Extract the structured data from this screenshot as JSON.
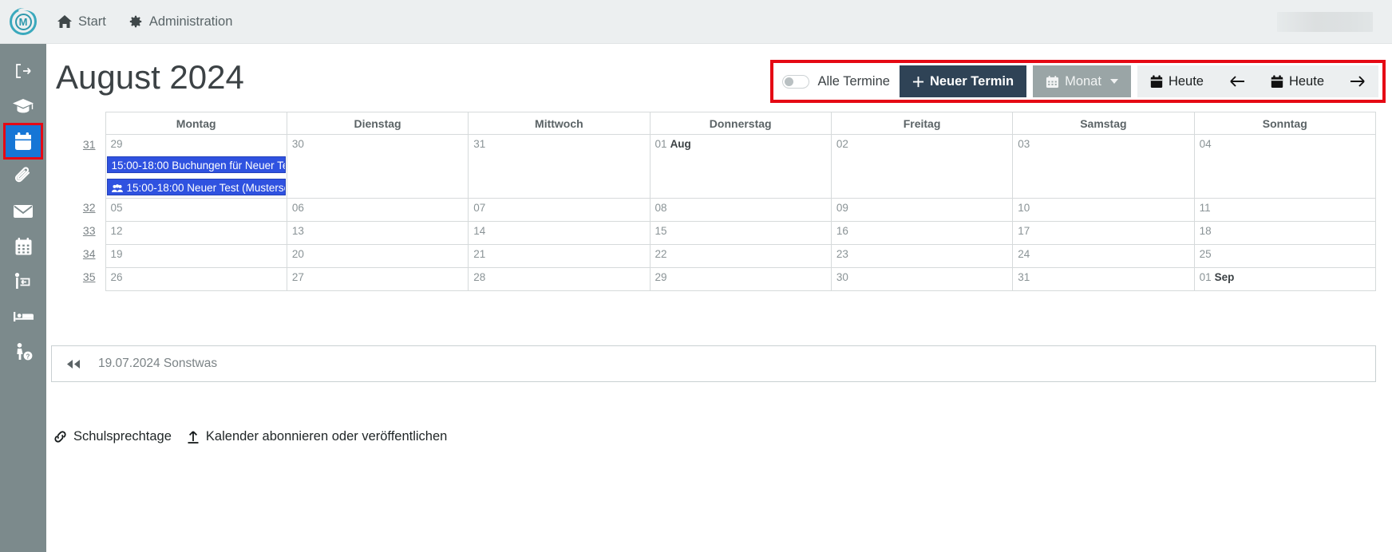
{
  "topbar": {
    "logo_letter": "M",
    "items": [
      {
        "label": "Start",
        "icon": "home-icon"
      },
      {
        "label": "Administration",
        "icon": "gear-icon"
      }
    ]
  },
  "sidebar": {
    "items": [
      {
        "icon": "logout-icon",
        "name": "sidebar-item-logout",
        "active": false
      },
      {
        "icon": "graduation-cap-icon",
        "name": "sidebar-item-school",
        "active": false
      },
      {
        "icon": "calendar-day-icon",
        "name": "sidebar-item-calendar",
        "active": true
      },
      {
        "icon": "paperclip-icon",
        "name": "sidebar-item-files",
        "active": false
      },
      {
        "icon": "envelope-icon",
        "name": "sidebar-item-messages",
        "active": false
      },
      {
        "icon": "calendar-grid-icon",
        "name": "sidebar-item-timetable",
        "active": false
      },
      {
        "icon": "person-exit-icon",
        "name": "sidebar-item-absence",
        "active": false
      },
      {
        "icon": "bed-icon",
        "name": "sidebar-item-boarding",
        "active": false
      },
      {
        "icon": "person-question-icon",
        "name": "sidebar-item-help",
        "active": false
      }
    ]
  },
  "page": {
    "title": "August 2024"
  },
  "toolbar": {
    "toggle_label": "Alle Termine",
    "toggle_on": false,
    "new_appointment": "Neuer Termin",
    "view_label": "Monat",
    "today_label": "Heute",
    "today_label_2": "Heute",
    "prev_icon": "arrow-left-icon",
    "next_icon": "arrow-right-icon",
    "highlight_color": "#e50914",
    "primary_color": "#2f4356"
  },
  "calendar": {
    "weekday_headers": [
      "Montag",
      "Dienstag",
      "Mittwoch",
      "Donnerstag",
      "Freitag",
      "Samstag",
      "Sonntag"
    ],
    "rows": [
      {
        "week": "31",
        "tall": true,
        "days": [
          {
            "num": "29",
            "month": "",
            "events": [
              {
                "time": "15:00-18:00",
                "title": "Buchungen für Neuer Test",
                "icon": "",
                "color": "#2f52e0"
              },
              {
                "time": "15:00-18:00",
                "title": "Neuer Test (Musterschu",
                "icon": "users-icon",
                "color": "#2f52e0"
              }
            ]
          },
          {
            "num": "30",
            "month": "",
            "events": []
          },
          {
            "num": "31",
            "month": "",
            "events": []
          },
          {
            "num": "01",
            "month": "Aug",
            "shaded": true,
            "events": []
          },
          {
            "num": "02",
            "month": "",
            "events": []
          },
          {
            "num": "03",
            "month": "",
            "events": []
          },
          {
            "num": "04",
            "month": "",
            "events": []
          }
        ]
      },
      {
        "week": "32",
        "days": [
          {
            "num": "05",
            "month": ""
          },
          {
            "num": "06",
            "month": ""
          },
          {
            "num": "07",
            "month": ""
          },
          {
            "num": "08",
            "month": ""
          },
          {
            "num": "09",
            "month": ""
          },
          {
            "num": "10",
            "month": ""
          },
          {
            "num": "11",
            "month": ""
          }
        ]
      },
      {
        "week": "33",
        "days": [
          {
            "num": "12",
            "month": ""
          },
          {
            "num": "13",
            "month": ""
          },
          {
            "num": "14",
            "month": ""
          },
          {
            "num": "15",
            "month": ""
          },
          {
            "num": "16",
            "month": ""
          },
          {
            "num": "17",
            "month": ""
          },
          {
            "num": "18",
            "month": ""
          }
        ]
      },
      {
        "week": "34",
        "days": [
          {
            "num": "19",
            "month": "",
            "greenline": true
          },
          {
            "num": "20",
            "month": ""
          },
          {
            "num": "21",
            "month": ""
          },
          {
            "num": "22",
            "month": ""
          },
          {
            "num": "23",
            "month": ""
          },
          {
            "num": "24",
            "month": ""
          },
          {
            "num": "25",
            "month": ""
          }
        ]
      },
      {
        "week": "35",
        "days": [
          {
            "num": "26",
            "month": "",
            "today": true
          },
          {
            "num": "27",
            "month": ""
          },
          {
            "num": "28",
            "month": ""
          },
          {
            "num": "29",
            "month": ""
          },
          {
            "num": "30",
            "month": ""
          },
          {
            "num": "31",
            "month": ""
          },
          {
            "num": "01",
            "month": "Sep"
          }
        ]
      }
    ]
  },
  "panel": {
    "rewind_icon": "rewind-icon",
    "text": "19.07.2024 Sonstwas"
  },
  "footer": {
    "links": [
      {
        "label": "Schulsprechtage",
        "icon": "link-icon"
      },
      {
        "label": "Kalender abonnieren oder veröffentlichen",
        "icon": "upload-icon"
      }
    ]
  }
}
